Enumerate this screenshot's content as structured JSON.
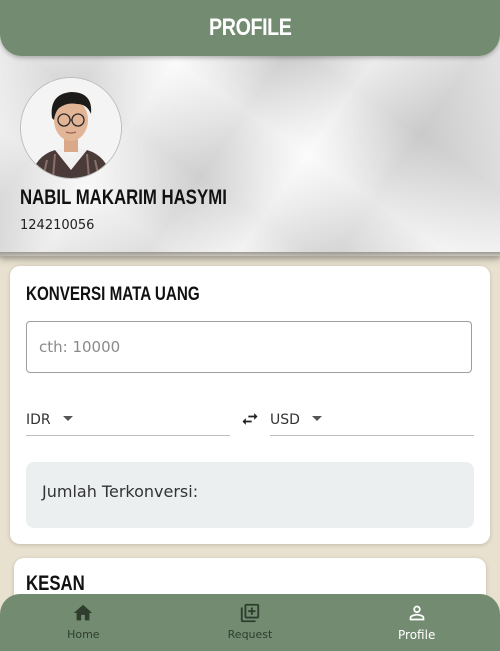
{
  "app_bar": {
    "title": "PROFILE"
  },
  "profile": {
    "name": "NABIL MAKARIM HASYMI",
    "nim": "124210056"
  },
  "converter": {
    "title": "KONVERSI MATA UANG",
    "amount_placeholder": "cth: 10000",
    "amount_value": "",
    "from_currency": "IDR",
    "to_currency": "USD",
    "result_label": "Jumlah Terkonversi:"
  },
  "kesan": {
    "title": "KESAN"
  },
  "bottom_nav": {
    "items": [
      {
        "label": "Home",
        "icon": "home-icon",
        "active": false
      },
      {
        "label": "Request",
        "icon": "library-add-icon",
        "active": false
      },
      {
        "label": "Profile",
        "icon": "person-icon",
        "active": true
      }
    ]
  },
  "colors": {
    "primary": "#738c71",
    "background": "#e9e1cf",
    "result_bg": "#ebeff0"
  }
}
